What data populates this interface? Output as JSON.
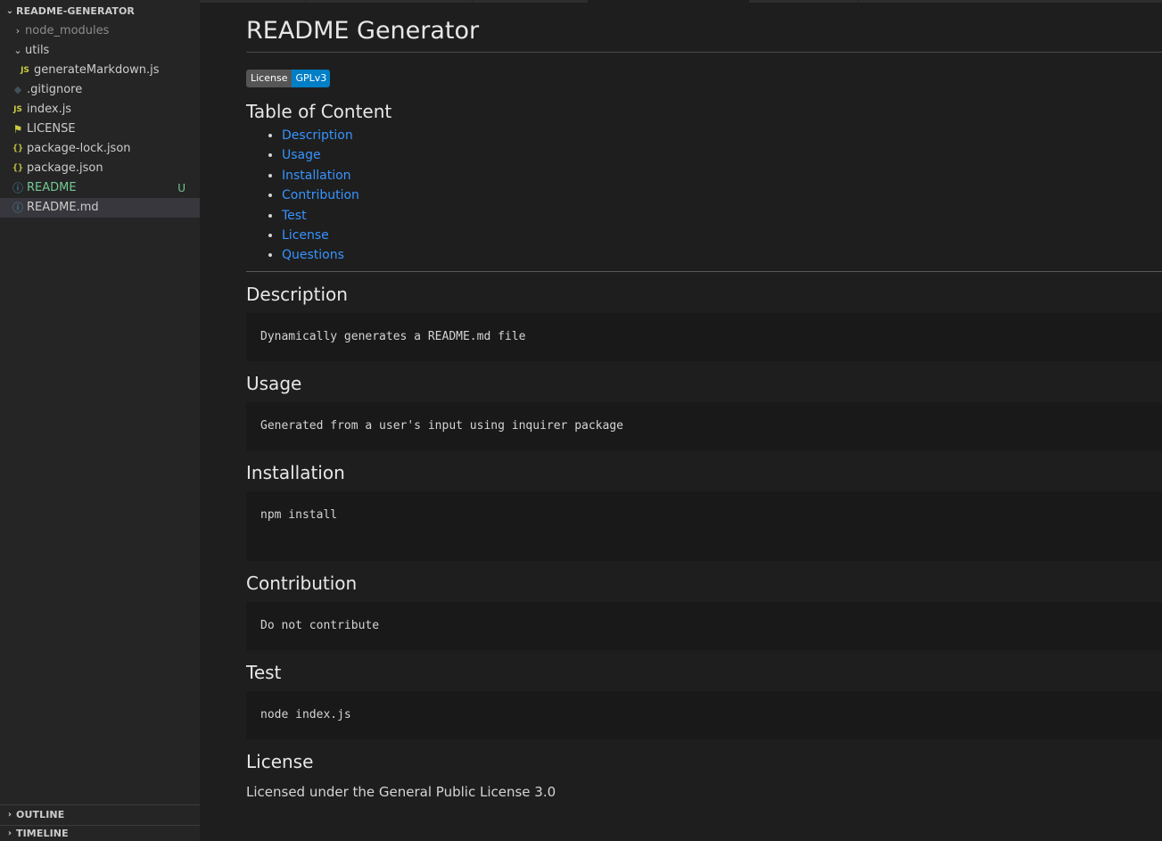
{
  "explorer": {
    "root_label": "README-GENERATOR",
    "items": [
      {
        "label": "node_modules",
        "type": "folder-collapsed",
        "icon": "chevron-right-icon"
      },
      {
        "label": "utils",
        "type": "folder-expanded",
        "icon": "chevron-down-icon"
      },
      {
        "label": "generateMarkdown.js",
        "type": "file",
        "icon": "js-file-icon",
        "icon_text": "JS"
      },
      {
        "label": ".gitignore",
        "type": "file",
        "icon": "git-file-icon"
      },
      {
        "label": "index.js",
        "type": "file",
        "icon": "js-file-icon",
        "icon_text": "JS"
      },
      {
        "label": "LICENSE",
        "type": "file",
        "icon": "license-file-icon"
      },
      {
        "label": "package-lock.json",
        "type": "file",
        "icon": "json-file-icon",
        "icon_text": "{}"
      },
      {
        "label": "package.json",
        "type": "file",
        "icon": "json-file-icon",
        "icon_text": "{}"
      },
      {
        "label": "README",
        "type": "file",
        "icon": "info-file-icon",
        "badge": "U"
      },
      {
        "label": "README.md",
        "type": "file",
        "icon": "info-file-icon"
      }
    ]
  },
  "panels": {
    "outline": "OUTLINE",
    "timeline": "TIMELINE"
  },
  "preview": {
    "title": "README Generator",
    "badge": {
      "left": "License",
      "right": "GPLv3",
      "left_color": "#555555",
      "right_color": "#007ec6"
    },
    "toc_title": "Table of Content",
    "toc": [
      "Description",
      "Usage",
      "Installation",
      "Contribution",
      "Test",
      "License",
      "Questions"
    ],
    "sections": {
      "description": {
        "heading": "Description",
        "code": "Dynamically generates a README.md file"
      },
      "usage": {
        "heading": "Usage",
        "code": "Generated from a user's input using inquirer package"
      },
      "installation": {
        "heading": "Installation",
        "code": "npm install"
      },
      "contribution": {
        "heading": "Contribution",
        "code": "Do not contribute"
      },
      "test": {
        "heading": "Test",
        "code": "node index.js"
      },
      "license": {
        "heading": "License",
        "text": "Licensed under the General Public License 3.0"
      }
    }
  },
  "colors": {
    "link": "#3794ff",
    "untracked": "#73c991",
    "sidebar_bg": "#252526",
    "editor_bg": "#1e1e1e"
  }
}
